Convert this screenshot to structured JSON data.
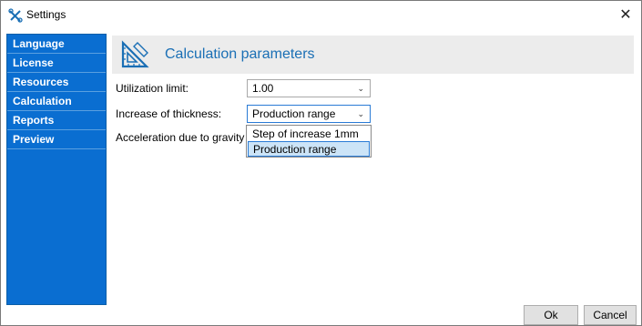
{
  "window": {
    "title": "Settings",
    "icon": "settings-tools-icon",
    "close_glyph": "✕"
  },
  "sidebar": {
    "items": [
      {
        "label": "Language"
      },
      {
        "label": "License"
      },
      {
        "label": "Resources"
      },
      {
        "label": "Calculation"
      },
      {
        "label": "Reports"
      },
      {
        "label": "Preview"
      }
    ]
  },
  "header": {
    "title": "Calculation parameters",
    "icon": "set-square-ruler-icon"
  },
  "form": {
    "utilization_limit": {
      "label": "Utilization limit:",
      "value": "1.00"
    },
    "increase_of_thickness": {
      "label": "Increase of thickness:",
      "value": "Production range"
    },
    "acceleration": {
      "label": "Acceleration due to gravity"
    }
  },
  "dropdown": {
    "options": [
      "Step of increase 1mm",
      "Production range"
    ],
    "selected": "Production range"
  },
  "buttons": {
    "ok": "Ok",
    "cancel": "Cancel"
  },
  "colors": {
    "sidebar_bg": "#0a6ed1",
    "header_title": "#1a6fb5",
    "selection": "#cce4f7",
    "focus_border": "#2a7bd5"
  }
}
